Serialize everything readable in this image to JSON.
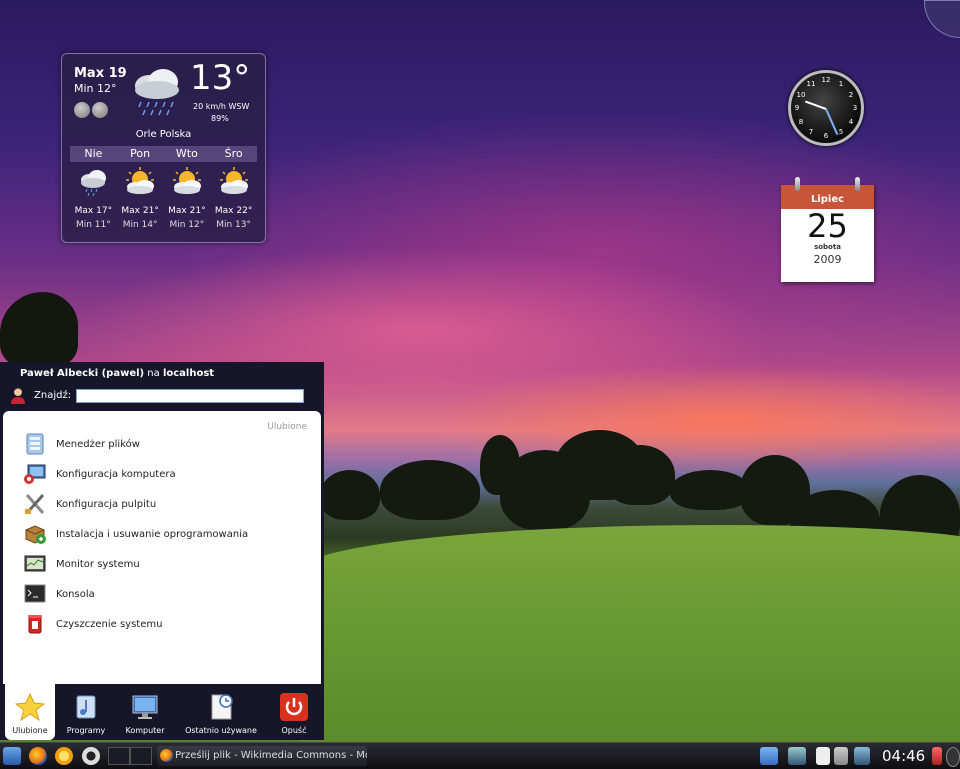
{
  "weather": {
    "max_today": "Max 19",
    "min_today": "Min 12°",
    "temperature": "13°",
    "wind": "20 km/h WSW",
    "humidity": "89%",
    "location": "Orle Polska",
    "days": [
      "Nie",
      "Pon",
      "Wto",
      "Śro"
    ],
    "forecast": [
      {
        "max": "Max 17°",
        "min": "Min 11°",
        "icon": "rain-cloud-icon"
      },
      {
        "max": "Max 21°",
        "min": "Min 14°",
        "icon": "sun-cloud-icon"
      },
      {
        "max": "Max 21°",
        "min": "Min 12°",
        "icon": "sun-cloud-icon"
      },
      {
        "max": "Max 22°",
        "min": "Min 13°",
        "icon": "sun-cloud-icon"
      }
    ]
  },
  "calendar": {
    "month": "Lipiec",
    "day": "25",
    "weekday": "sobota",
    "year": "2009"
  },
  "kickoff": {
    "user_name": "Paweł Albecki (pawel)",
    "user_connector": " na ",
    "host": "localhost",
    "search_label": "Znajdź:",
    "search_value": "",
    "section_title": "Ulubione",
    "items": [
      {
        "label": "Menedżer plików",
        "icon": "file-manager-icon"
      },
      {
        "label": "Konfiguracja komputera",
        "icon": "system-settings-icon"
      },
      {
        "label": "Konfiguracja pulpitu",
        "icon": "desktop-settings-icon"
      },
      {
        "label": "Instalacja i usuwanie oprogramowania",
        "icon": "package-manager-icon"
      },
      {
        "label": "Monitor systemu",
        "icon": "system-monitor-icon"
      },
      {
        "label": "Konsola",
        "icon": "terminal-icon"
      },
      {
        "label": "Czyszczenie systemu",
        "icon": "system-cleaner-icon"
      }
    ],
    "tabs": [
      {
        "label": "Ulubione",
        "icon": "star-icon"
      },
      {
        "label": "Programy",
        "icon": "applications-icon"
      },
      {
        "label": "Komputer",
        "icon": "computer-icon"
      },
      {
        "label": "Ostatnio używane",
        "icon": "recent-documents-icon"
      },
      {
        "label": "Opuść",
        "icon": "power-icon"
      }
    ]
  },
  "taskbar": {
    "task_title": "Prześlij plik - Wikimedia Commons - Mo",
    "clock": "04:46"
  }
}
